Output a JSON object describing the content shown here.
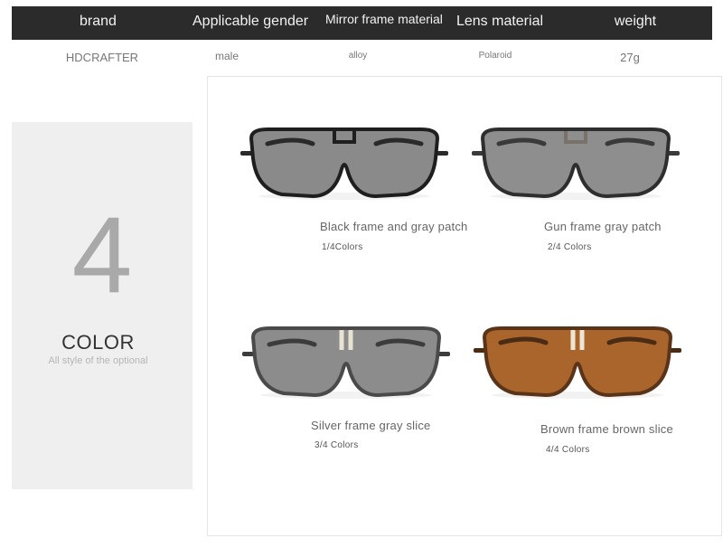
{
  "specs": {
    "headers": [
      "brand",
      "Applicable gender",
      "Mirror frame material",
      "Lens material",
      "weight"
    ],
    "values": [
      "HDCRAFTER",
      "male",
      "alloy",
      "Polaroid",
      "27g"
    ]
  },
  "color_panel": {
    "number": "4",
    "title": "COLOR",
    "subtitle": "All style of the optional"
  },
  "products": [
    {
      "name": "Black frame and gray patch",
      "count": "1/4Colors",
      "frame_color": "#1e1e1e",
      "lens_color": "#8a8a8a",
      "temple_color": "#2a2a2a",
      "bridge_color": "#1e1e1e"
    },
    {
      "name": "Gun frame gray patch",
      "count": "2/4 Colors",
      "frame_color": "#2e2e2e",
      "lens_color": "#8e8e8e",
      "temple_color": "#3a3a3a",
      "bridge_color": "#7a7268"
    },
    {
      "name": "Silver frame gray slice",
      "count": "3/4 Colors",
      "frame_color": "#4a4a4a",
      "lens_color": "#8c8c8c",
      "temple_color": "#3c3c3c",
      "bridge_color": "#e8e2d2"
    },
    {
      "name": "Brown frame brown slice",
      "count": "4/4 Colors",
      "frame_color": "#5a3418",
      "lens_color": "#a9652c",
      "temple_color": "#4a2c14",
      "bridge_color": "#eee6d4"
    }
  ]
}
